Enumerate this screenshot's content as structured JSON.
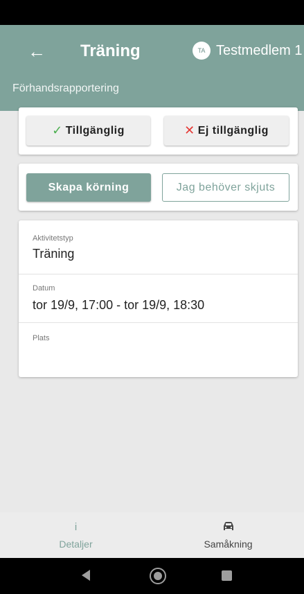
{
  "header": {
    "back_icon": "arrow-left-icon",
    "title": "Träning",
    "avatar_initials": "TA",
    "member_name": "Testmedlem 1",
    "subtitle": "Förhandsrapportering"
  },
  "availability": {
    "available_label": "Tillgänglig",
    "available_icon": "check-icon",
    "unavailable_label": "Ej tillgänglig",
    "unavailable_icon": "cross-icon"
  },
  "actions": {
    "create_ride_label": "Skapa körning",
    "need_ride_label": "Jag behöver skjuts"
  },
  "details": {
    "activity_type_label": "Aktivitetstyp",
    "activity_type_value": "Träning",
    "date_label": "Datum",
    "date_value": "tor 19/9, 17:00 - tor 19/9, 18:30",
    "location_label": "Plats",
    "location_value": ""
  },
  "bottom_nav": {
    "details_label": "Detaljer",
    "details_icon": "info-icon",
    "carpool_label": "Samåkning",
    "carpool_icon": "car-icon"
  },
  "colors": {
    "accent": "#7fa39b",
    "check": "#4caf50",
    "cross": "#e53935"
  }
}
